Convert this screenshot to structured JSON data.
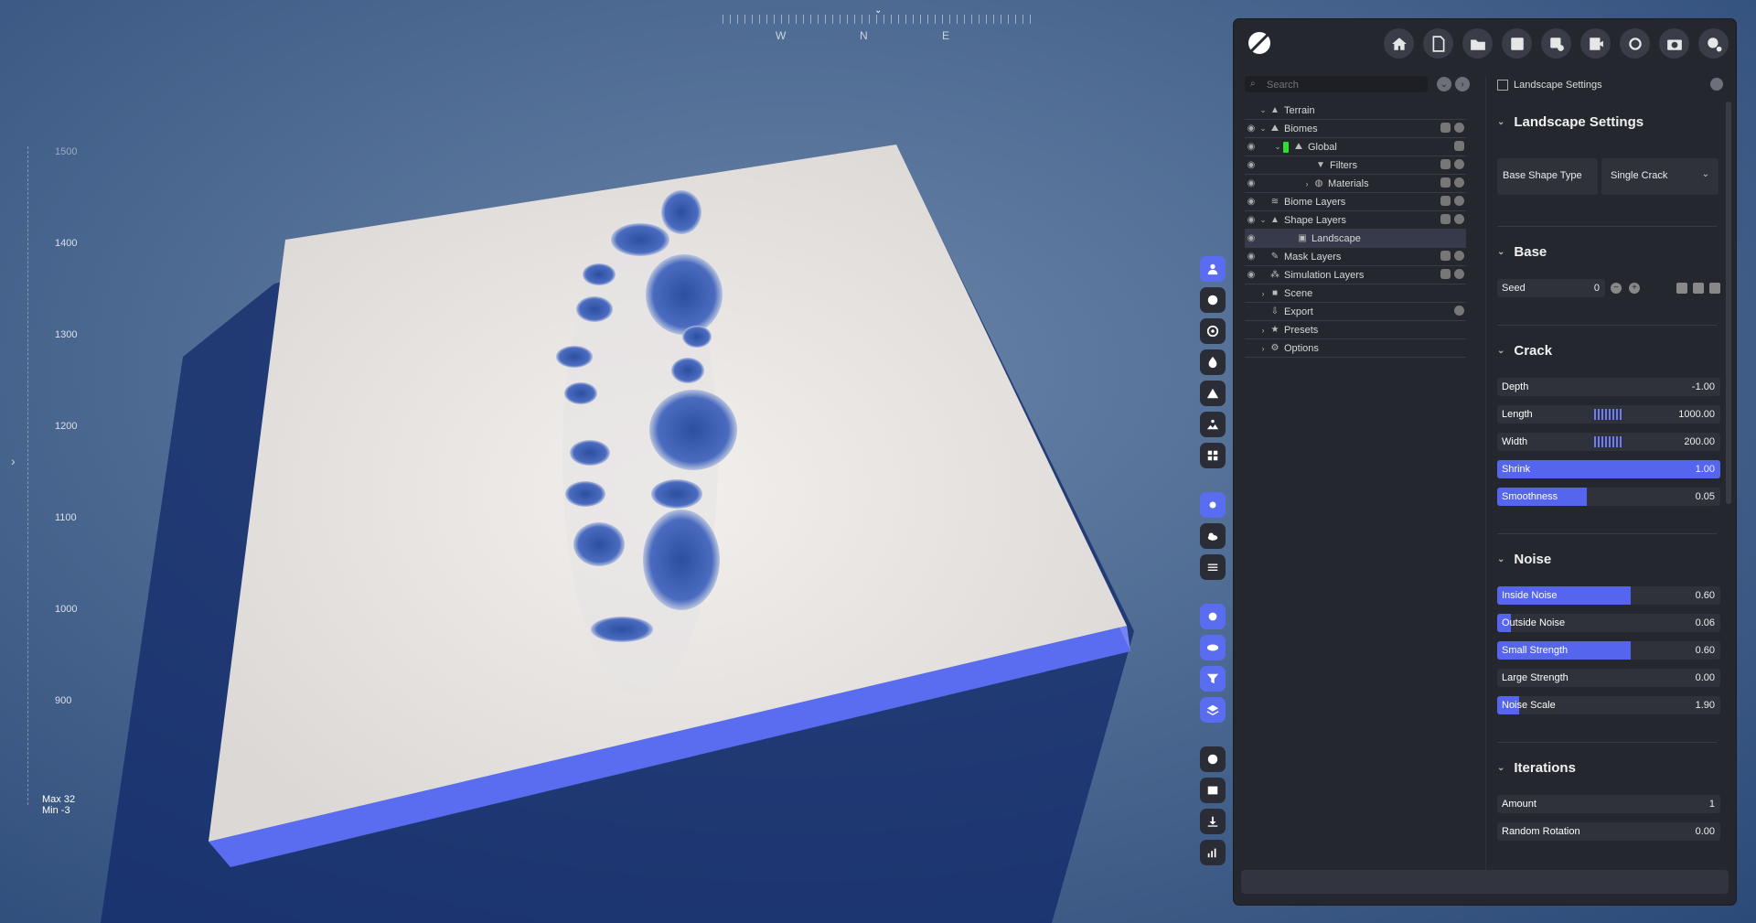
{
  "compass": {
    "labels": [
      "W",
      "N",
      "E"
    ]
  },
  "ruler": {
    "ticks": [
      "1500",
      "1400",
      "1300",
      "1200",
      "1100",
      "1000",
      "900"
    ],
    "max_label": "Max 32",
    "min_label": "Min -3"
  },
  "toolbar_icons": [
    "person-icon",
    "globe-icon",
    "target-icon",
    "fire-icon",
    "mountain-icon",
    "terrain-icon",
    "grid-icon",
    "sun-icon",
    "cloud-icon",
    "wind-icon",
    "settings-icon",
    "eye-icon",
    "filter-icon",
    "layers-icon",
    "record-icon",
    "image-icon",
    "download-icon",
    "chart-icon"
  ],
  "top_actions": [
    "home",
    "new-file",
    "open-folder",
    "save",
    "save-as",
    "export",
    "refresh",
    "screenshot",
    "help"
  ],
  "tree": {
    "search_placeholder": "Search",
    "items": [
      {
        "label": "Terrain"
      },
      {
        "label": "Biomes"
      },
      {
        "label": "Global"
      },
      {
        "label": "Filters"
      },
      {
        "label": "Materials"
      },
      {
        "label": "Biome Layers"
      },
      {
        "label": "Shape Layers"
      },
      {
        "label": "Landscape"
      },
      {
        "label": "Mask Layers"
      },
      {
        "label": "Simulation Layers"
      },
      {
        "label": "Scene"
      },
      {
        "label": "Export"
      },
      {
        "label": "Presets"
      },
      {
        "label": "Options"
      }
    ]
  },
  "settings": {
    "header": "Landscape Settings",
    "section_landscape": "Landscape Settings",
    "base_shape_label": "Base Shape Type",
    "base_shape_value": "Single Crack",
    "section_base": "Base",
    "seed_label": "Seed",
    "seed_value": "0",
    "section_crack": "Crack",
    "crack": [
      {
        "label": "Depth",
        "value": "-1.00",
        "fill": 0
      },
      {
        "label": "Length",
        "value": "1000.00",
        "fill": 0
      },
      {
        "label": "Width",
        "value": "200.00",
        "fill": 0
      },
      {
        "label": "Shrink",
        "value": "1.00",
        "fill": 1.0
      },
      {
        "label": "Smoothness",
        "value": "0.05",
        "fill": 0.4
      }
    ],
    "section_noise": "Noise",
    "noise": [
      {
        "label": "Inside Noise",
        "value": "0.60",
        "fill": 0.6
      },
      {
        "label": "Outside Noise",
        "value": "0.06",
        "fill": 0.06
      },
      {
        "label": "Small Strength",
        "value": "0.60",
        "fill": 0.6
      },
      {
        "label": "Large Strength",
        "value": "0.00",
        "fill": 0
      },
      {
        "label": "Noise Scale",
        "value": "1.90",
        "fill": 0.1
      }
    ],
    "section_iterations": "Iterations",
    "iterations": [
      {
        "label": "Amount",
        "value": "1",
        "fill": 0
      },
      {
        "label": "Random Rotation",
        "value": "0.00",
        "fill": 0
      }
    ]
  },
  "colors": {
    "accent": "#5565ee",
    "panel": "#25272e",
    "terrain_side": "#5a6cf0"
  }
}
